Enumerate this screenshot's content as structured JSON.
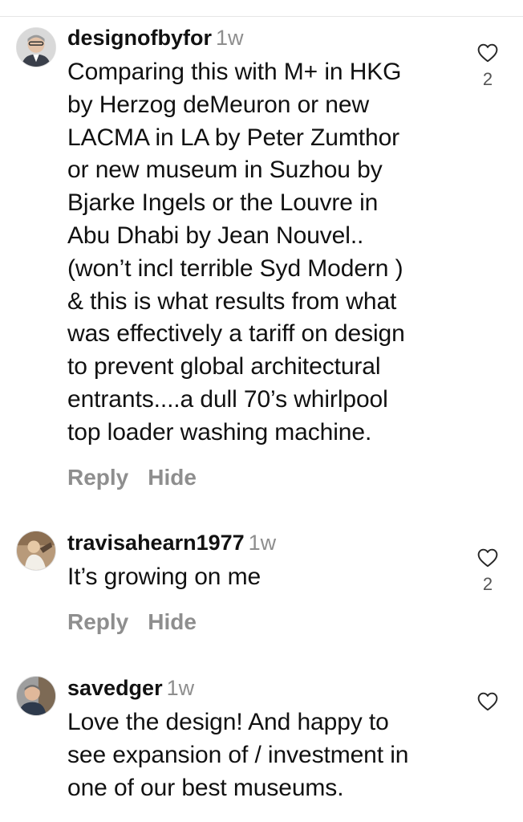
{
  "comments": [
    {
      "username": "designofbyfor",
      "time": "1w",
      "lines": [
        "Comparing this with M+ in HKG",
        "by Herzog deMeuron or new",
        "LACMA in LA by Peter Zumthor",
        "or new museum in Suzhou by",
        "Bjarke Ingels or the Louvre in",
        "Abu Dhabi by Jean Nouvel..",
        "(won’t incl terrible Syd Modern )",
        "& this is what results from what",
        "was effectively a tariff on design",
        "to prevent global architectural",
        "entrants....a dull 70’s whirlpool",
        "top loader washing machine."
      ],
      "reply_label": "Reply",
      "hide_label": "Hide",
      "like_count": "2",
      "like_icon": "heart-outline-icon"
    },
    {
      "username": "travisahearn1977",
      "time": "1w",
      "lines": [
        "It’s growing on me"
      ],
      "reply_label": "Reply",
      "hide_label": "Hide",
      "like_count": "2",
      "like_icon": "heart-outline-icon"
    },
    {
      "username": "savedger",
      "time": "1w",
      "lines": [
        "Love the design! And happy to",
        "see expansion of / investment in",
        "one of our best museums."
      ],
      "like_icon": "heart-outline-icon"
    }
  ],
  "colors": {
    "text": "#111111",
    "secondary": "#8e8e8e",
    "like_count": "#555555",
    "divider": "#e6e6e6"
  }
}
